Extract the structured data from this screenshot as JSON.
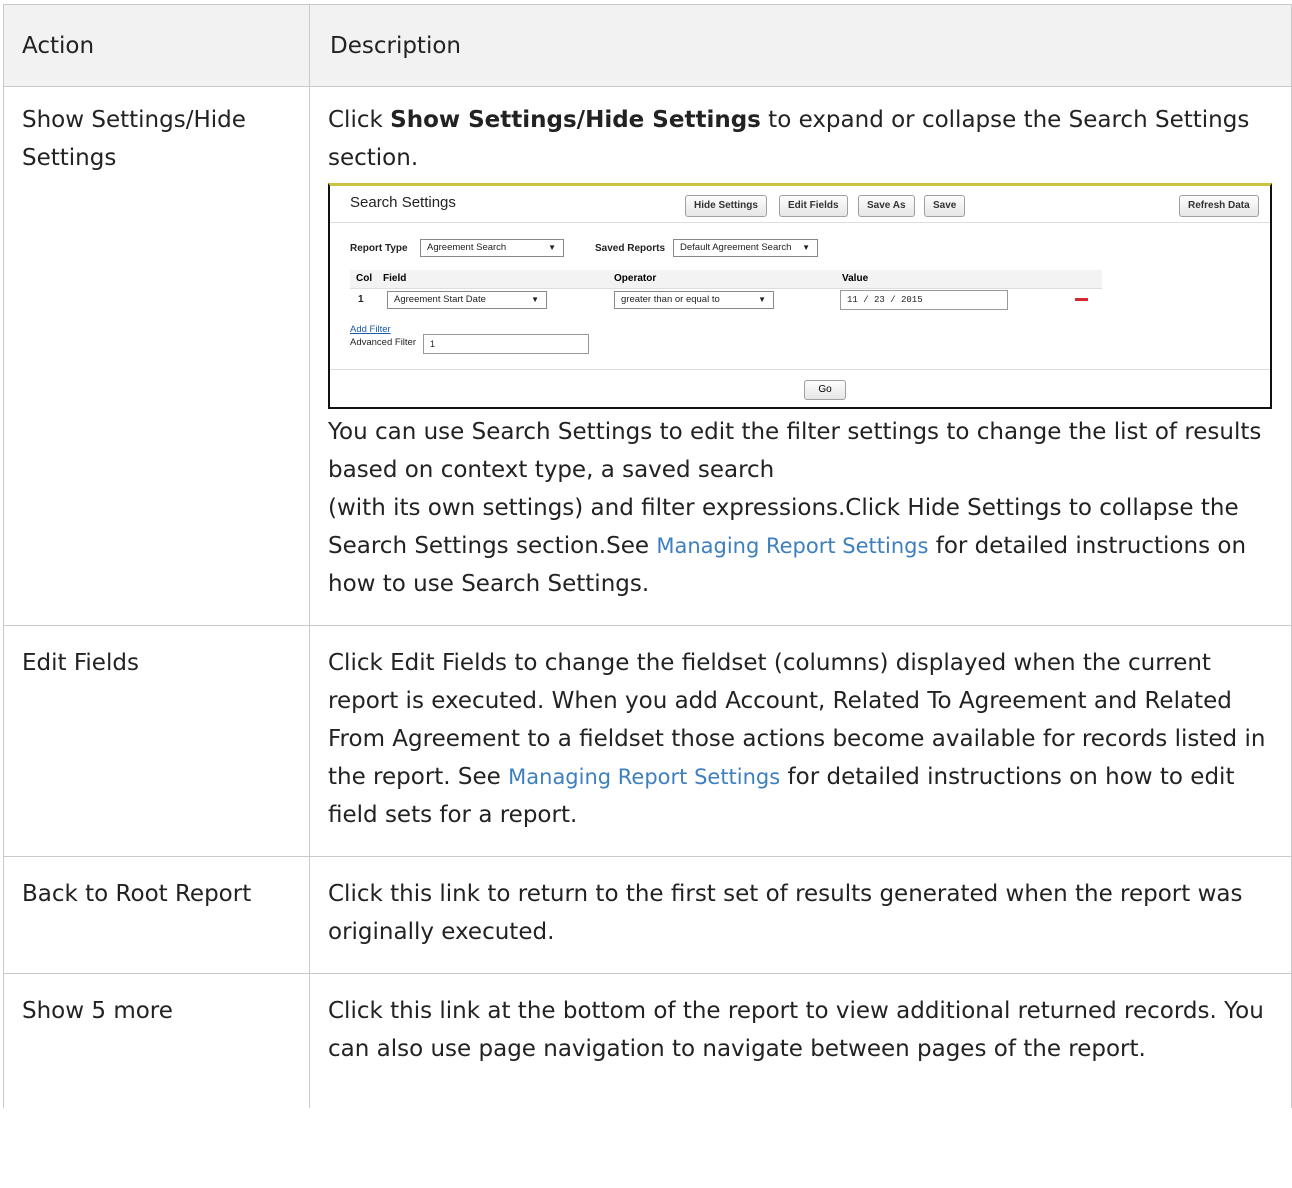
{
  "table": {
    "headers": {
      "action": "Action",
      "description": "Description"
    },
    "rows": [
      {
        "action": "Show Settings/Hide Settings",
        "desc_pre": "Click ",
        "desc_bold": "Show Settings/Hide Settings",
        "desc_post": " to expand or collapse the Search Settings section.",
        "after_a": "You can use Search Settings to edit the filter settings to change the list of results based on context type, a saved search",
        "after_b": "(with its own settings) and filter expressions.Click Hide Settings to collapse the Search Settings section.See ",
        "after_link": "Managing Report Settings",
        "after_c": " for detailed instructions on how to use Search Settings."
      },
      {
        "action": "Edit Fields",
        "desc_a": "Click Edit Fields to change the fieldset (columns) displayed when the current report is executed. When you add Account, Related To Agreement and Related From Agreement to a fieldset those actions become available for records listed in the report. See ",
        "desc_link": "Managing Report Settings",
        "desc_b": " for detailed instructions on how to edit field sets for a report."
      },
      {
        "action": "Back to Root Report",
        "desc": "Click this link to return to the first set of results generated when the report was originally executed."
      },
      {
        "action": "Show 5 more",
        "desc": "Click this link at the bottom of the report to view additional returned records. You can also use page navigation to navigate between pages of the report."
      }
    ]
  },
  "screenshot": {
    "title": "Search Settings",
    "buttons": {
      "hide_settings": "Hide Settings",
      "edit_fields": "Edit Fields",
      "save_as": "Save As",
      "save": "Save",
      "refresh": "Refresh Data"
    },
    "report_type_label": "Report Type",
    "report_type_value": "Agreement Search",
    "saved_reports_label": "Saved Reports",
    "saved_reports_value": "Default Agreement Search",
    "grid_headers": {
      "col": "Col",
      "field": "Field",
      "operator": "Operator",
      "value": "Value"
    },
    "row": {
      "col": "1",
      "field": "Agreement Start Date",
      "operator": "greater than or equal to",
      "value": "11 / 23 / 2015"
    },
    "add_filter": "Add Filter",
    "advanced_filter_label": "Advanced Filter",
    "advanced_filter_value": "1",
    "go": "Go",
    "arrow": "▼",
    "accent_color": "#c9c341",
    "remove_color": "#d8252f"
  }
}
